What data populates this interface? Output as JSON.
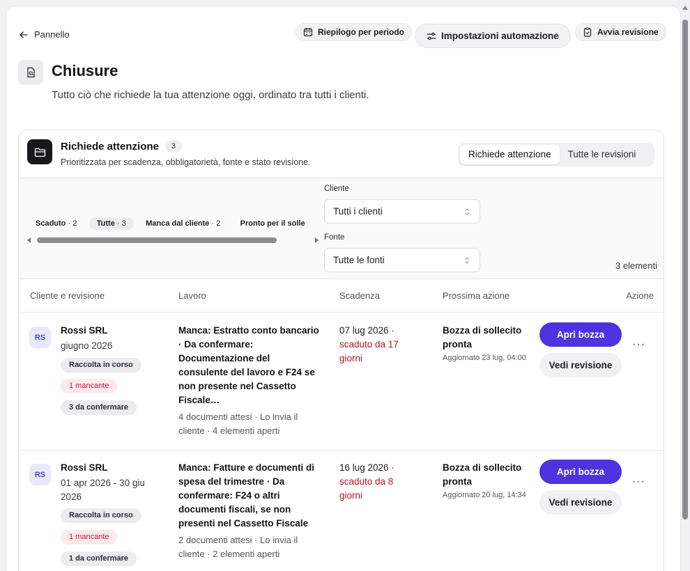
{
  "nav": {
    "back_label": "Pannello"
  },
  "toolbar": {
    "summary_label": "Riepilogo per periodo",
    "automation_label": "Impostazioni automazione",
    "start_review_label": "Avvia revisione"
  },
  "header": {
    "title": "Chiusure",
    "subtitle": "Tutto ciò che richiede la tua attenzione oggi, ordinato tra tutti i clienti."
  },
  "section": {
    "title": "Richiede attenzione",
    "count": "3",
    "subtitle": "Prioritizzata per scadenza, obbligatorietà, fonte e stato revisione.",
    "tabs": [
      {
        "label": "Richiede attenzione",
        "active": true
      },
      {
        "label": "Tutte le revisioni",
        "active": false
      }
    ]
  },
  "filters": {
    "chips": [
      {
        "label": "Scaduto",
        "count": "· 2",
        "selected": false
      },
      {
        "label": "Tutte",
        "count": "· 3",
        "selected": true
      },
      {
        "label": "Manca dal cliente",
        "count": "· 2",
        "selected": false
      },
      {
        "label": "Pronto per il solle",
        "count": "",
        "selected": false
      }
    ],
    "client": {
      "label": "Cliente",
      "value": "Tutti i clienti"
    },
    "source": {
      "label": "Fonte",
      "value": "Tutte le fonti"
    },
    "count_text": "3 elementi"
  },
  "table": {
    "headers": [
      "Cliente e revisione",
      "Lavoro",
      "Scadenza",
      "Prossima azione",
      "Azione"
    ],
    "rows": [
      {
        "initials": "RS",
        "client": "Rossi SRL",
        "period": "giugno 2026",
        "tags": [
          {
            "label": "Raccolta in corso",
            "style": "grey"
          },
          {
            "label": "1 mancante",
            "style": "red"
          },
          {
            "label": "3 da confermare",
            "style": "grey"
          }
        ],
        "work": "Manca: Estratto conto bancario · Da confermare: Documentazione del consulente del lavoro e F24 se non presente nel Cassetto Fiscale…",
        "work_meta": "4 documenti attesi · Lo invia il cliente · 4 elementi aperti",
        "due_date": "07 lug 2026 ·",
        "due_status": "scaduto da 17 giorni",
        "next_action": "Bozza di sollecito pronta",
        "updated": "Aggiornato 23 lug, 04:00",
        "primary_label": "Apri bozza",
        "secondary_label": "Vedi revisione"
      },
      {
        "initials": "RS",
        "client": "Rossi SRL",
        "period": "01 apr 2026 - 30 giu 2026",
        "tags": [
          {
            "label": "Raccolta in corso",
            "style": "grey"
          },
          {
            "label": "1 mancante",
            "style": "red"
          },
          {
            "label": "1 da confermare",
            "style": "grey"
          }
        ],
        "work": "Manca: Fatture e documenti di spesa del trimestre · Da confermare: F24 o altri documenti fiscali, se non presenti nel Cassetto Fiscale",
        "work_meta": "2 documenti attesi · Lo invia il cliente · 2 elementi aperti",
        "due_date": "16 lug 2026 ·",
        "due_status": "scaduto da 8 giorni",
        "next_action": "Bozza di sollecito pronta",
        "updated": "Aggiornato 20 lug, 14:34",
        "primary_label": "Apri bozza",
        "secondary_label": "Vedi revisione"
      }
    ]
  },
  "colors": {
    "primary": "#4f33e0",
    "danger": "#b3121f",
    "tag_red_bg": "#fde8ec"
  }
}
